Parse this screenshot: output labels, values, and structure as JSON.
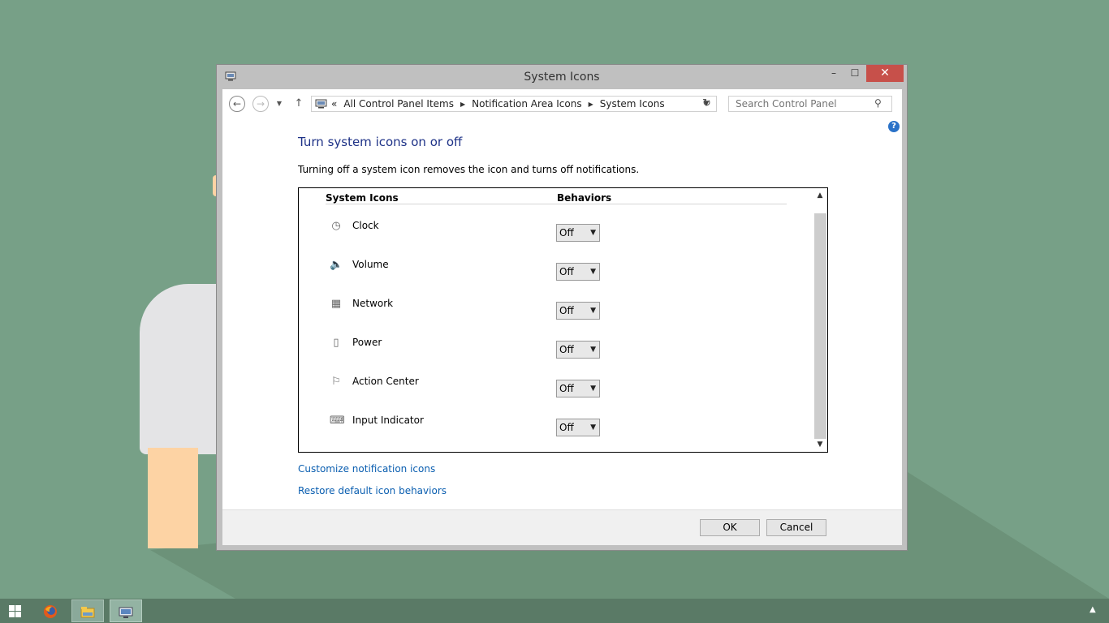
{
  "window": {
    "title": "System Icons",
    "controls": {
      "minimize": "–",
      "maximize": "☐",
      "close": "✕"
    }
  },
  "navbar": {
    "back_icon": "←",
    "forward_icon": "→",
    "recent_icon": "▼",
    "up_icon": "↑",
    "breadcrumb": {
      "prefix": "«",
      "items": [
        "All Control Panel Items",
        "Notification Area Icons",
        "System Icons"
      ],
      "separator": "▶"
    },
    "address_dropdown_icon": "▼",
    "refresh_icon": "↻",
    "search_placeholder": "Search Control Panel",
    "search_icon": "⚲"
  },
  "help_icon": "?",
  "content": {
    "heading": "Turn system icons on or off",
    "description": "Turning off a system icon removes the icon and turns off notifications.",
    "columns": {
      "icons": "System Icons",
      "behaviors": "Behaviors"
    },
    "rows": [
      {
        "label": "Clock",
        "icon": "clock-icon",
        "glyph": "◷",
        "value": "Off"
      },
      {
        "label": "Volume",
        "icon": "volume-icon",
        "glyph": "🔈",
        "value": "Off"
      },
      {
        "label": "Network",
        "icon": "network-icon",
        "glyph": "▦",
        "value": "Off"
      },
      {
        "label": "Power",
        "icon": "power-icon",
        "glyph": "▯",
        "value": "Off"
      },
      {
        "label": "Action Center",
        "icon": "flag-icon",
        "glyph": "⚐",
        "value": "Off"
      },
      {
        "label": "Input Indicator",
        "icon": "keyboard-icon",
        "glyph": "⌨",
        "value": "Off"
      }
    ],
    "links": {
      "customize": "Customize notification icons",
      "restore": "Restore default icon behaviors"
    }
  },
  "footer": {
    "ok": "OK",
    "cancel": "Cancel"
  },
  "colors": {
    "desktop": "#77a087",
    "heading": "#1e3287",
    "link": "#0a5eb0",
    "close_button": "#c7504a",
    "taskbar": "#5a7a66"
  }
}
